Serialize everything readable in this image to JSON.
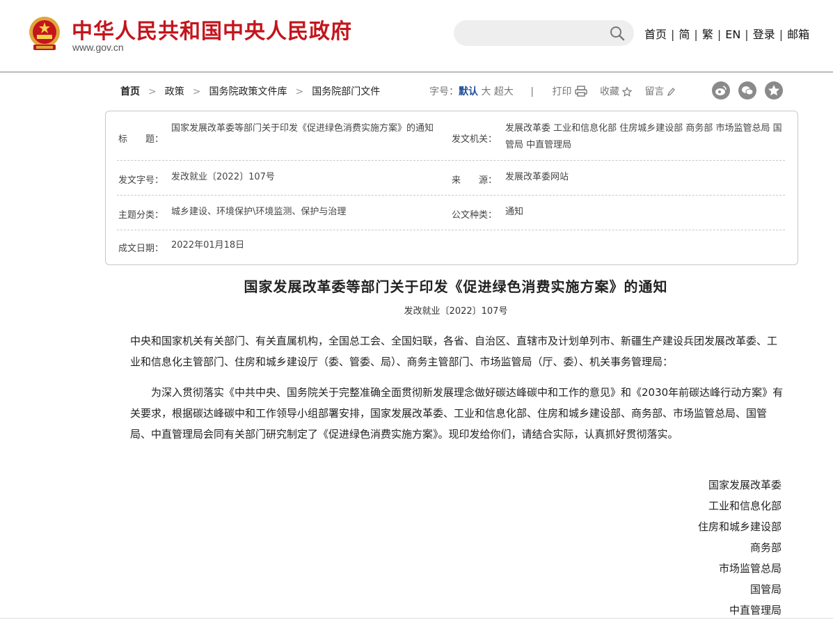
{
  "header": {
    "site_title": "中华人民共和国中央人民政府",
    "site_url": "www.gov.cn",
    "search": {
      "placeholder": ""
    },
    "links": [
      "首页",
      "简",
      "繁",
      "EN",
      "登录",
      "邮箱"
    ]
  },
  "breadcrumb": [
    "首页",
    "政策",
    "国务院政策文件库",
    "国务院部门文件"
  ],
  "tools": {
    "font_label": "字号：",
    "font_default": "默认",
    "font_large": "大",
    "font_xlarge": "超大",
    "divider": "|",
    "print": "打印",
    "favorite": "收藏",
    "comment": "留言"
  },
  "info": {
    "title_label": "标　　题：",
    "title_value": "国家发展改革委等部门关于印发《促进绿色消费实施方案》的通知",
    "issuer_label": "发文机关：",
    "issuer_value": "发展改革委  工业和信息化部  住房城乡建设部  商务部  市场监管总局  国管局  中直管理局",
    "doc_no_label": "发文字号：",
    "doc_no_value": "发改就业〔2022〕107号",
    "source_label": "来　　源：",
    "source_value": "发展改革委网站",
    "topic_label": "主题分类：",
    "topic_value": "城乡建设、环境保护\\环境监测、保护与治理",
    "type_label": "公文种类：",
    "type_value": "通知",
    "date_label": "成文日期：",
    "date_value": "2022年01月18日"
  },
  "document": {
    "title": "国家发展改革委等部门关于印发《促进绿色消费实施方案》的通知",
    "doc_no": "发改就业〔2022〕107号",
    "para1": "中央和国家机关有关部门、有关直属机构，全国总工会、全国妇联，各省、自治区、直辖市及计划单列市、新疆生产建设兵团发展改革委、工业和信息化主管部门、住房和城乡建设厅（委、管委、局）、商务主管部门、市场监管局（厅、委）、机关事务管理局：",
    "para2": "为深入贯彻落实《中共中央、国务院关于完整准确全面贯彻新发展理念做好碳达峰碳中和工作的意见》和《2030年前碳达峰行动方案》有关要求，根据碳达峰碳中和工作领导小组部署安排，国家发展改革委、工业和信息化部、住房和城乡建设部、商务部、市场监管总局、国管局、中直管理局会同有关部门研究制定了《促进绿色消费实施方案》。现印发给你们，请结合实际，认真抓好贯彻落实。",
    "signatories": [
      "国家发展改革委",
      "工业和信息化部",
      "住房和城乡建设部",
      "商务部",
      "市场监管总局",
      "国管局",
      "中直管理局"
    ]
  },
  "colors": {
    "brand_red": "#c4151c",
    "accent_blue": "#1f4e9a"
  }
}
